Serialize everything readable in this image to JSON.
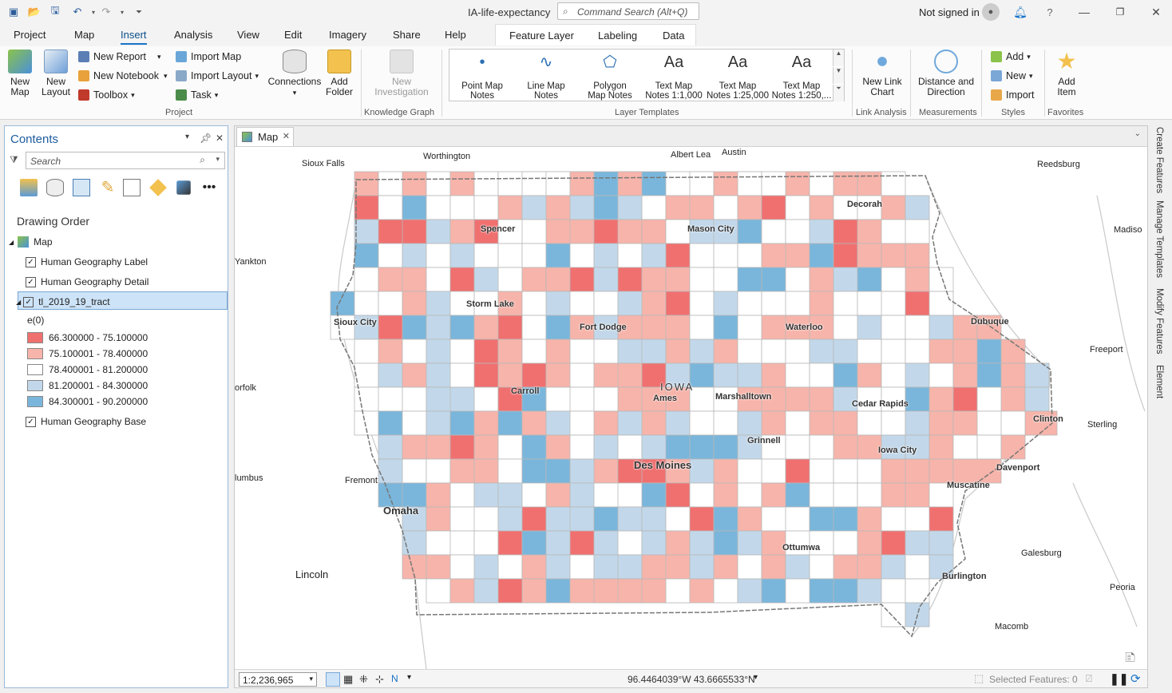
{
  "window": {
    "title": "IA-life-expectancy",
    "command_search_placeholder": "Command Search (Alt+Q)",
    "signin_text": "Not signed in"
  },
  "tabs": [
    "Project",
    "Map",
    "Insert",
    "Analysis",
    "View",
    "Edit",
    "Imagery",
    "Share",
    "Help"
  ],
  "active_tab": "Insert",
  "context_tabs": [
    "Feature Layer",
    "Labeling",
    "Data"
  ],
  "ribbon": {
    "project_group": {
      "label": "Project",
      "new_map": "New\nMap",
      "new_layout": "New\nLayout",
      "new_report": "New Report",
      "new_notebook": "New Notebook",
      "toolbox": "Toolbox",
      "import_map": "Import Map",
      "import_layout": "Import Layout",
      "task": "Task",
      "connections": "Connections",
      "add_folder": "Add\nFolder"
    },
    "knowledge_graph": {
      "label": "Knowledge Graph",
      "new_investigation": "New\nInvestigation"
    },
    "layer_templates": {
      "label": "Layer Templates",
      "items": [
        {
          "l1": "Point Map",
          "l2": "Notes",
          "icon": "point"
        },
        {
          "l1": "Line Map",
          "l2": "Notes",
          "icon": "line"
        },
        {
          "l1": "Polygon",
          "l2": "Map Notes",
          "icon": "polygon"
        },
        {
          "l1": "Text Map",
          "l2": "Notes 1:1,000",
          "icon": "Aa"
        },
        {
          "l1": "Text Map",
          "l2": "Notes 1:25,000",
          "icon": "Aa"
        },
        {
          "l1": "Text Map",
          "l2": "Notes 1:250,...",
          "icon": "Aa"
        }
      ]
    },
    "link_analysis": {
      "label": "Link Analysis",
      "new_link_chart": "New Link\nChart"
    },
    "measurements": {
      "label": "Measurements",
      "distance_direction": "Distance and\nDirection"
    },
    "styles": {
      "label": "Styles",
      "add": "Add",
      "new": "New",
      "import": "Import"
    },
    "favorites": {
      "label": "Favorites",
      "add_item": "Add\nItem"
    }
  },
  "contents": {
    "title": "Contents",
    "search_placeholder": "Search",
    "drawing_order": "Drawing Order",
    "map": "Map",
    "layers": [
      "Human Geography Label",
      "Human Geography Detail",
      "tl_2019_19_tract"
    ],
    "legend_field": "e(0)",
    "legend": [
      {
        "label": "66.300000 - 75.100000",
        "color": "#f07070"
      },
      {
        "label": "75.100001 - 78.400000",
        "color": "#f7b4aa"
      },
      {
        "label": "78.400001 - 81.200000",
        "color": "#ffffff"
      },
      {
        "label": "81.200001 - 84.300000",
        "color": "#c2d8ea"
      },
      {
        "label": "84.300001 - 90.200000",
        "color": "#7ab6db"
      }
    ],
    "base_layer": "Human Geography Base"
  },
  "map": {
    "tab": "Map",
    "scale": "1:2,236,965",
    "coordinates": "96.4464039°W 43.6665533°N",
    "selected_features": "Selected Features: 0",
    "state_label": "IOWA",
    "labels": [
      {
        "t": "Worthington",
        "cls": ""
      },
      {
        "t": "Albert Lea",
        "cls": ""
      },
      {
        "t": "Austin",
        "cls": ""
      },
      {
        "t": "Sioux Falls",
        "cls": ""
      },
      {
        "t": "Reedsburg",
        "cls": ""
      },
      {
        "t": "Decorah",
        "cls": "city"
      },
      {
        "t": "Spencer",
        "cls": "city"
      },
      {
        "t": "Mason City",
        "cls": "city"
      },
      {
        "t": "Madiso",
        "cls": ""
      },
      {
        "t": "Yankton",
        "cls": ""
      },
      {
        "t": "Storm Lake",
        "cls": "city"
      },
      {
        "t": "Sioux City",
        "cls": "city"
      },
      {
        "t": "Fort Dodge",
        "cls": "city"
      },
      {
        "t": "Waterloo",
        "cls": "city"
      },
      {
        "t": "Dubuque",
        "cls": "city"
      },
      {
        "t": "Freeport",
        "cls": ""
      },
      {
        "t": "Carroll",
        "cls": "city"
      },
      {
        "t": "Ames",
        "cls": "city"
      },
      {
        "t": "Marshalltown",
        "cls": "city"
      },
      {
        "t": "Cedar Rapids",
        "cls": "city"
      },
      {
        "t": "orfolk",
        "cls": ""
      },
      {
        "t": "Clinton",
        "cls": "city"
      },
      {
        "t": "Sterling",
        "cls": ""
      },
      {
        "t": "Grinnell",
        "cls": "city"
      },
      {
        "t": "Des Moines",
        "cls": "city"
      },
      {
        "t": "Iowa City",
        "cls": "city"
      },
      {
        "t": "Davenport",
        "cls": "city"
      },
      {
        "t": "lumbus",
        "cls": ""
      },
      {
        "t": "Fremont",
        "cls": ""
      },
      {
        "t": "Muscatine",
        "cls": "city"
      },
      {
        "t": "Omaha",
        "cls": "city"
      },
      {
        "t": "Ottumwa",
        "cls": "city"
      },
      {
        "t": "Galesburg",
        "cls": ""
      },
      {
        "t": "Lincoln",
        "cls": ""
      },
      {
        "t": "Burlington",
        "cls": "city"
      },
      {
        "t": "Peoria",
        "cls": ""
      },
      {
        "t": "Macomb",
        "cls": ""
      }
    ]
  },
  "dock_tabs": [
    "Create Features",
    "Manage Templates",
    "Modify Features",
    "Element"
  ]
}
